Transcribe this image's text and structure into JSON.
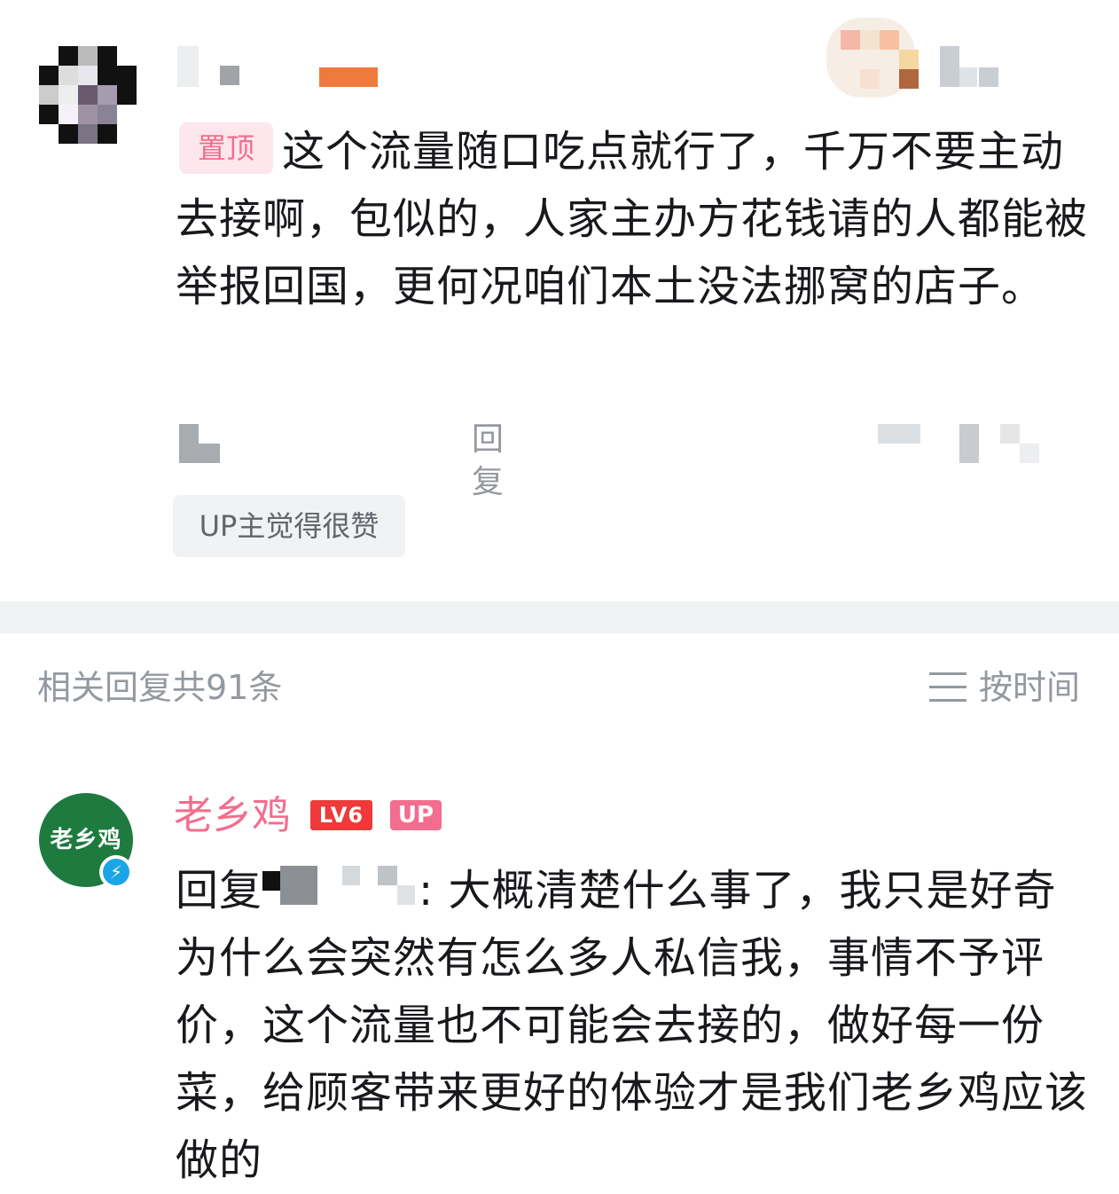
{
  "pinned_comment": {
    "tag": "置顶",
    "text": "这个流量随口吃点就行了，千万不要主动去接啊，包似的，人家主办方花钱请的人都能被举报回国，更何况咱们本土没法挪窝的店子。",
    "reply_label": "回复",
    "up_liked_label": "UP主觉得很赞"
  },
  "replies_header": {
    "count_text": "相关回复共91条",
    "sort_label": "按时间",
    "sort_icon": "list-icon"
  },
  "reply_comment": {
    "avatar_text": "老乡鸡",
    "username": "老乡鸡",
    "level_badge": "LV6",
    "up_badge": "UP",
    "verify_icon": "lightning-icon",
    "reply_prefix": "回复",
    "text": ": 大概清楚什么事了，我只是好奇为什么会突然有怎么多人私信我，事情不予评价，这个流量也不可能会去接的，做好每一份菜，给顾客带来更好的体验才是我们老乡鸡应该做的"
  },
  "colors": {
    "accent_pink": "#f36d8e",
    "level_red": "#ee3a3a",
    "avatar_green": "#1e7a3f",
    "muted_gray": "#9499a0"
  }
}
